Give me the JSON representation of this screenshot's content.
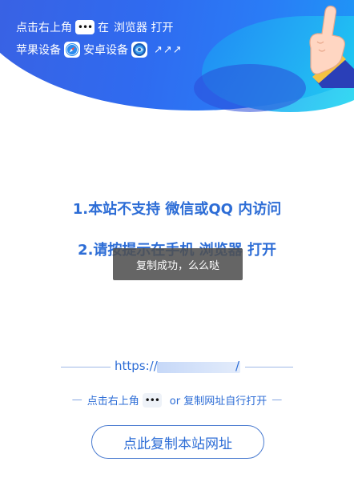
{
  "banner": {
    "line1_prefix": "点击右上角",
    "line1_dots": "•••",
    "line1_middle": "在",
    "line1_suffix": "浏览器 打开",
    "line2_apple": "苹果设备",
    "line2_android": "安卓设备",
    "line2_arrows": "↗↗↗"
  },
  "headings": {
    "line1": "1.本站不支持 微信或QQ 内访问",
    "line2": "2.请按提示在手机 浏览器 打开"
  },
  "toast": {
    "text": "复制成功，么么哒"
  },
  "url": {
    "prefix": "https://",
    "suffix": "/"
  },
  "hint": {
    "dash_left": "—",
    "prefix": "点击右上角",
    "dots": "•••",
    "middle": "or 复制网址自行打开",
    "dash_right": "—"
  },
  "copy_button": {
    "label": "点此复制本站网址"
  },
  "colors": {
    "accent": "#2d6dd6",
    "banner": "#2f6bf0",
    "toast_bg": "#505050"
  },
  "icons": [
    "more-dots-icon",
    "safari-icon",
    "android-browser-icon",
    "pointing-hand-icon"
  ]
}
